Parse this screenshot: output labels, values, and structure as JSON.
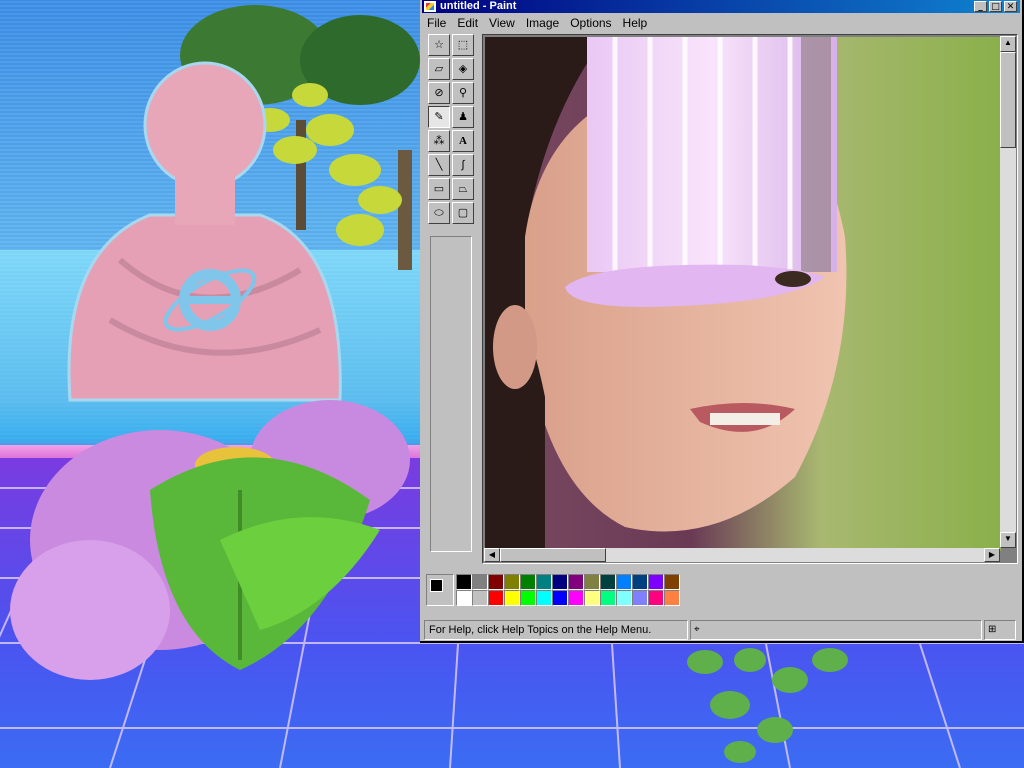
{
  "window": {
    "title": "untitled - Paint",
    "controls": {
      "minimize": "_",
      "maximize": "□",
      "close": "✕"
    }
  },
  "menu": {
    "items": [
      {
        "label": "File"
      },
      {
        "label": "Edit"
      },
      {
        "label": "View"
      },
      {
        "label": "Image"
      },
      {
        "label": "Options"
      },
      {
        "label": "Help"
      }
    ]
  },
  "tools": [
    {
      "name": "free-form-select",
      "glyph": "☆"
    },
    {
      "name": "rectangle-select",
      "glyph": "⬚"
    },
    {
      "name": "eraser",
      "glyph": "▱"
    },
    {
      "name": "fill-with-color",
      "glyph": "◈"
    },
    {
      "name": "pick-color",
      "glyph": "⊘"
    },
    {
      "name": "magnifier",
      "glyph": "⚲"
    },
    {
      "name": "pencil",
      "glyph": "✎"
    },
    {
      "name": "brush",
      "glyph": "♟"
    },
    {
      "name": "airbrush",
      "glyph": "⁂"
    },
    {
      "name": "text",
      "glyph": "A"
    },
    {
      "name": "line",
      "glyph": "╲"
    },
    {
      "name": "curve",
      "glyph": "∫"
    },
    {
      "name": "rectangle",
      "glyph": "▭"
    },
    {
      "name": "polygon",
      "glyph": "⏢"
    },
    {
      "name": "ellipse",
      "glyph": "⬭"
    },
    {
      "name": "rounded-rectangle",
      "glyph": "▢"
    }
  ],
  "selected_tool": "pencil",
  "palette": {
    "foreground": "#000000",
    "background": "#ffffff",
    "top_row": [
      "#000000",
      "#808080",
      "#800000",
      "#808000",
      "#008000",
      "#008080",
      "#000080",
      "#800080",
      "#808040",
      "#004040",
      "#0080ff",
      "#004080",
      "#8000ff",
      "#804000"
    ],
    "bottom_row": [
      "#ffffff",
      "#c0c0c0",
      "#ff0000",
      "#ffff00",
      "#00ff00",
      "#00ffff",
      "#0000ff",
      "#ff00ff",
      "#ffff80",
      "#00ff80",
      "#80ffff",
      "#8080ff",
      "#ff0080",
      "#ff8040"
    ]
  },
  "status": {
    "help_text": "For Help, click Help Topics on the Help Menu."
  },
  "colors": {
    "title_bar": "#000080",
    "window_face": "#c0c0c0"
  }
}
